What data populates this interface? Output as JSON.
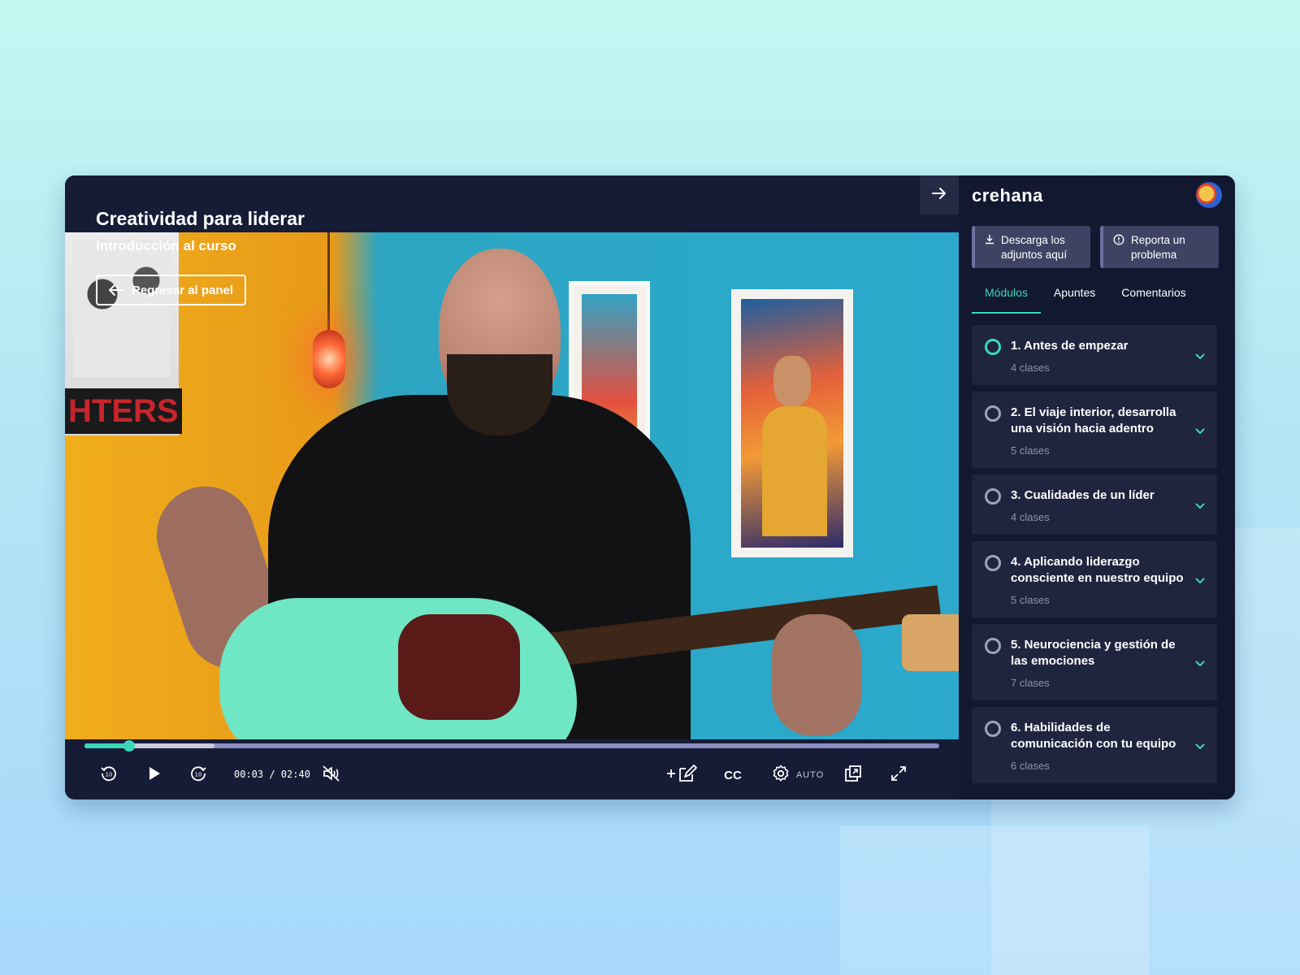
{
  "player": {
    "course_title": "Creatividad para liderar",
    "lesson_title": "Introducción al curso",
    "back_button": "Regresar al panel",
    "current_time": "00:03",
    "duration": "02:40",
    "time_display": "00:03 / 02:40",
    "played_fraction": 0.052,
    "buffered_fraction": 0.152,
    "cc_label": "CC",
    "quality_label": "AUTO",
    "icons": [
      "rewind-10-icon",
      "play-icon",
      "forward-10-icon",
      "mute-icon",
      "add-note-icon",
      "settings-icon",
      "picture-in-picture-icon",
      "fullscreen-icon",
      "arrow-right-icon"
    ],
    "colors": {
      "accent": "#3ad8b7",
      "background": "#171c36"
    }
  },
  "sidebar": {
    "logo": "crehana",
    "download_button": "Descarga los adjuntos aquí",
    "report_button": "Reporta un problema",
    "tabs": [
      {
        "label": "Módulos",
        "active": true
      },
      {
        "label": "Apuntes",
        "active": false
      },
      {
        "label": "Comentarios",
        "active": false
      }
    ],
    "modules": [
      {
        "name": "1. Antes de empezar",
        "count": "4 clases",
        "active": true
      },
      {
        "name": "2. El viaje interior, desarrolla una visión hacia adentro",
        "count": "5 clases",
        "active": false
      },
      {
        "name": "3. Cualidades de un líder",
        "count": "4 clases",
        "active": false
      },
      {
        "name": "4. Aplicando liderazgo consciente en nuestro equipo",
        "count": "5 clases",
        "active": false
      },
      {
        "name": "5. Neurociencia y gestión de las emociones",
        "count": "7 clases",
        "active": false
      },
      {
        "name": "6. Habilidades de comunicación con tu equipo",
        "count": "6 clases",
        "active": false
      }
    ]
  }
}
